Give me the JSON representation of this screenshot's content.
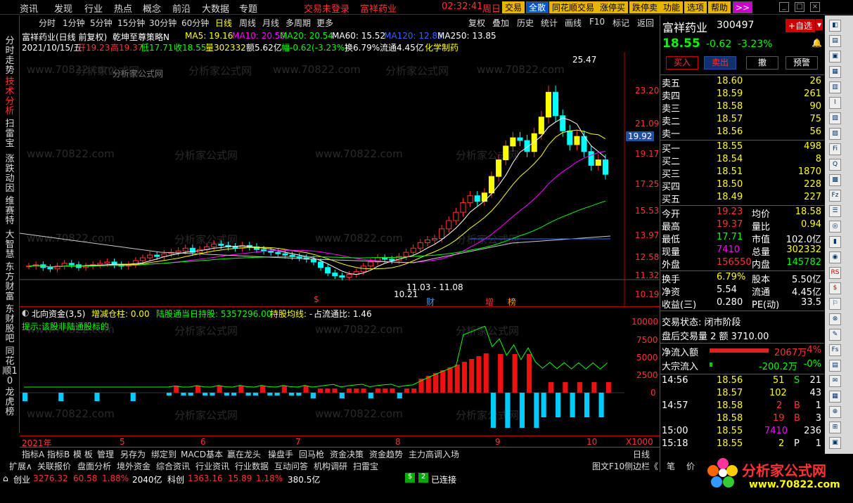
{
  "menu": {
    "items": [
      "资讯",
      "发现",
      "行业",
      "热点",
      "概念",
      "前沿",
      "大数据",
      "专题"
    ],
    "trade_status": "交易未登录",
    "stock": "富祥药业",
    "time": "02:32:41",
    "weekday": "周日"
  },
  "topbtns": [
    "复权",
    "叠加",
    "历史",
    "统计",
    "画线",
    "F10",
    "标记",
    "返回"
  ],
  "toolbar_right": [
    "交易",
    "全散",
    "同花顺交易",
    "涨停买",
    "跌停卖",
    "功能",
    "选项",
    "帮助",
    ">>"
  ],
  "leftnav": [
    "分时走势",
    "技术分析",
    "扫雷宝",
    "涨跌动因",
    "维赛特",
    "大智慧",
    "东方财富",
    "东财股吧",
    "同花顺10",
    "龙虎榜"
  ],
  "periods": [
    "分时",
    "1分钟",
    "5分钟",
    "15分钟",
    "30分钟",
    "60分钟",
    "日线",
    "周线",
    "月线",
    "多周期",
    "更多"
  ],
  "kline_info": {
    "name": "富祥药业(日线 前复权)",
    "strategy": "乾坤至尊策略N",
    "ma5": "MA5: 19.16",
    "ma10": "MA10: 20.50",
    "ma20": "MA20: 20.54",
    "ma60": "MA60: 15.52",
    "ma120": "MA120: 12.83",
    "ma250": "MA250: 13.85"
  },
  "day_info": {
    "date": "2021/10/15/五",
    "open": "开19.23",
    "high": "高19.37",
    "low": "低17.71",
    "close": "收18.55",
    "vol": "量302332",
    "amt": "额5.62亿",
    "chg": "幅-0.62(-3.23%)",
    "turn": "换6.79%",
    "float": "流通4.45亿",
    "concept": "化学制药"
  },
  "watermark": "分析家公式网",
  "watermark2": "www.70822.com",
  "price_axis": [
    "23.20",
    "21.09",
    "19.17",
    "17.25",
    "15.53",
    "13.97",
    "12.58",
    "11.32",
    "10.19"
  ],
  "current_price_tag": "19.92",
  "high_mark": "25.47",
  "low_mark": "10.21",
  "range_mark": "11.03 - 11.08",
  "event_marks": [
    "$",
    "财",
    "增",
    "榜"
  ],
  "sub_indicator": {
    "title": "北向资金(3,5)",
    "hold": "增减仓柱: 0.00",
    "hold_total": "陆股通当日持股: 5357296.00",
    "avg": "持股均线: -",
    "ratio": "占流通比: 1.46",
    "tip": "提示:该股非陆通股标的"
  },
  "sub_axis": [
    "10000",
    "7500",
    "5000",
    "2500",
    "0"
  ],
  "months": [
    "2021年",
    "5",
    "6",
    "7",
    "8",
    "9",
    "10"
  ],
  "x_zoom": "X1000",
  "chart_data": {
    "type": "candlestick",
    "title": "富祥药业(日线 前复权)",
    "ylim": [
      10.19,
      25.47
    ],
    "series_summary": {
      "last_close": 18.55,
      "high": 25.47,
      "low": 10.21
    },
    "closes": [
      11.9,
      12.0,
      11.8,
      11.7,
      11.9,
      12.1,
      12.0,
      11.8,
      11.9,
      12.0,
      12.1,
      12.2,
      12.0,
      11.9,
      12.0,
      12.3,
      12.5,
      12.7,
      12.6,
      12.8,
      12.9,
      13.0,
      13.2,
      12.9,
      13.1,
      13.3,
      13.5,
      13.4,
      13.3,
      13.2,
      13.4,
      13.3,
      13.1,
      13.0,
      12.9,
      12.8,
      12.7,
      12.6,
      12.5,
      12.4,
      12.2,
      11.8,
      11.4,
      11.2,
      11.1,
      11.3,
      11.5,
      11.9,
      12.2,
      12.5,
      12.4,
      12.3,
      12.6,
      12.9,
      13.2,
      13.6,
      13.8,
      13.9,
      14.6,
      15.2,
      15.8,
      16.5,
      17.0,
      16.6,
      17.2,
      18.4,
      19.6,
      20.6,
      21.2,
      21.0,
      20.2,
      21.5,
      22.7,
      24.5,
      22.8,
      21.7,
      20.7,
      21.3,
      20.2,
      19.2,
      19.6,
      18.55
    ]
  },
  "quote": {
    "name": "富祥药业",
    "code": "300497",
    "add_btn": "+自选",
    "price": "18.55",
    "chg": "-0.62",
    "pct": "-3.23%",
    "buy": "买入",
    "sell": "卖出",
    "cancel": "撤",
    "alert": "预警",
    "asks": [
      [
        "卖五",
        "18.60",
        "26"
      ],
      [
        "卖四",
        "18.59",
        "261"
      ],
      [
        "卖三",
        "18.58",
        "90"
      ],
      [
        "卖二",
        "18.57",
        "75"
      ],
      [
        "卖一",
        "18.56",
        "56"
      ]
    ],
    "bids": [
      [
        "买一",
        "18.55",
        "498"
      ],
      [
        "买二",
        "18.54",
        "8"
      ],
      [
        "买三",
        "18.51",
        "1870"
      ],
      [
        "买四",
        "18.50",
        "228"
      ],
      [
        "买五",
        "18.49",
        "227"
      ]
    ],
    "stats": [
      [
        "今开",
        "19.23",
        "均价",
        "18.58"
      ],
      [
        "最高",
        "19.37",
        "量比",
        "0.94"
      ],
      [
        "最低",
        "17.71",
        "市值",
        "102.0亿"
      ],
      [
        "现量",
        "7410",
        "总量",
        "302332"
      ],
      [
        "外盘",
        "156550",
        "内盘",
        "145782"
      ],
      [
        "换手",
        "6.79%",
        "股本",
        "5.50亿"
      ],
      [
        "净资",
        "5.54",
        "流通",
        "4.45亿"
      ],
      [
        "收益(三)",
        "0.280",
        "PE(动)",
        "33.5"
      ]
    ],
    "trade_state": "交易状态: 闭市阶段",
    "after_vol": "盘后交易量 2 额 3710.00",
    "netflow_label": "净流入额",
    "netflow_val": "2067万",
    "netflow_pct": "4%",
    "bigflow_label": "大宗流入",
    "bigflow_val": "-200.2万",
    "bigflow_pct": "-0%",
    "ticks": [
      [
        "14:56",
        "18.56",
        "51",
        "S",
        "21"
      ],
      [
        "",
        "18.57",
        "102",
        "",
        "43"
      ],
      [
        "14:57",
        "18.58",
        "2",
        "B",
        "1"
      ],
      [
        "",
        "18.58",
        "19",
        "B",
        "3"
      ],
      [
        "15:00",
        "18.55",
        "7410",
        "",
        "236"
      ],
      [
        "15:18",
        "18.55",
        "2",
        "P",
        "1"
      ]
    ]
  },
  "bottom_tabs": [
    "指标A",
    "指标B",
    "模 板",
    "管理",
    "另存为",
    "绑定到",
    "MACD基本",
    "赢在龙头",
    "操盘手",
    "回马枪",
    "资金决策",
    "资金趋势",
    "主力高调入场"
  ],
  "period_label": "日线",
  "bottom_tabs2": [
    "扩展∧",
    "关联报价",
    "盘面分析",
    "境外资金",
    "综合资讯",
    "行业资讯",
    "行业数据",
    "互动问答",
    "机构调研",
    "扫雷宝"
  ],
  "bottom_right": [
    "图文F10",
    "侧边栏《",
    "笔",
    "价"
  ],
  "status": {
    "idx": "创业",
    "idx_val": "3276.32",
    "idx_chg": "60.58",
    "idx_pct": "1.88%",
    "idx_amt": "2040亿",
    "idx2": "科创",
    "idx2_val": "1363.16",
    "idx2_chg": "15.89",
    "idx2_pct": "1.18%",
    "idx2_amt": "380.5亿",
    "conn": "已连接"
  },
  "brand": {
    "name": "分析家公式网",
    "url": "www.70822.com"
  }
}
